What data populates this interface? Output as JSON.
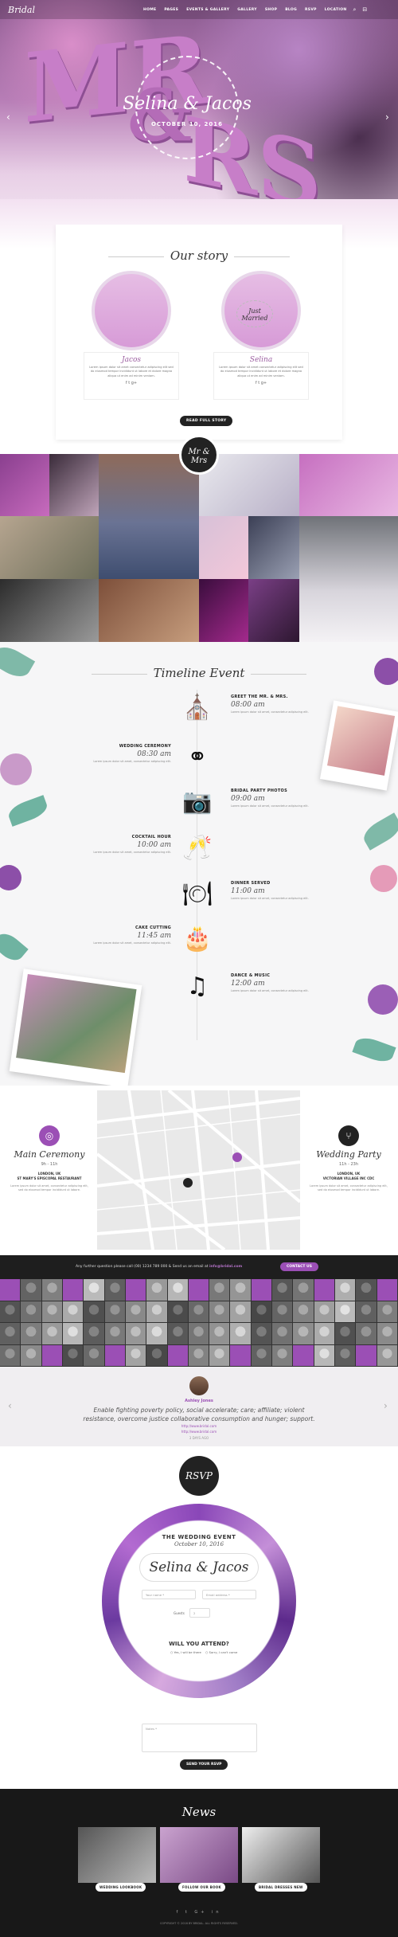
{
  "brand": "Bridal",
  "nav": [
    "HOME",
    "PAGES",
    "EVENTS & GALLERY",
    "GALLERY",
    "SHOP",
    "BLOG",
    "RSVP",
    "LOCATION"
  ],
  "hero": {
    "names": "Selina & Jacos",
    "date": "OCTOBER 10, 2016"
  },
  "story": {
    "title": "Our story",
    "ornament": "Just Married",
    "groom": {
      "name": "Jacos",
      "text": "Lorem ipsum dolor sit amet consectetur adipiscing elit sed do eiusmod tempor incididunt ut labore et dolore magna aliqua ut enim ad minim veniam.",
      "social": "f  t  g+"
    },
    "bride": {
      "name": "Selina",
      "text": "Lorem ipsum dolor sit amet consectetur adipiscing elit sed do eiusmod tempor incididunt ut labore et dolore magna aliqua ut enim ad minim veniam.",
      "social": "f  t  g+"
    },
    "button": "READ FULL STORY"
  },
  "gallery_badge": "Mr & Mrs",
  "timeline": {
    "title": "Timeline Event",
    "events": [
      {
        "title": "GREET THE MR. & MRS.",
        "time": "08:00 am",
        "desc": "Lorem ipsum dolor sit amet, consectetur adipiscing elit.",
        "icon": "church-icon",
        "glyph": "⛪"
      },
      {
        "title": "WEDDING CEREMONY",
        "time": "08:30 am",
        "desc": "Lorem ipsum dolor sit amet, consectetur adipiscing elit.",
        "icon": "rings-icon",
        "glyph": "⚭"
      },
      {
        "title": "BRIDAL PARTY PHOTOS",
        "time": "09:00 am",
        "desc": "Lorem ipsum dolor sit amet, consectetur adipiscing elit.",
        "icon": "camera-icon",
        "glyph": "📷"
      },
      {
        "title": "COCKTAIL HOUR",
        "time": "10:00 am",
        "desc": "Lorem ipsum dolor sit amet, consectetur adipiscing elit.",
        "icon": "glasses-icon",
        "glyph": "🥂"
      },
      {
        "title": "DINNER SERVED",
        "time": "11:00 am",
        "desc": "Lorem ipsum dolor sit amet, consectetur adipiscing elit.",
        "icon": "dinner-icon",
        "glyph": "🍽"
      },
      {
        "title": "CAKE CUTTING",
        "time": "11:45 am",
        "desc": "Lorem ipsum dolor sit amet, consectetur adipiscing elit.",
        "icon": "cake-icon",
        "glyph": "🎂"
      },
      {
        "title": "DANCE & MUSIC",
        "time": "12:00 am",
        "desc": "Lorem ipsum dolor sit amet, consectetur adipiscing elit.",
        "icon": "music-icon",
        "glyph": "♫"
      }
    ]
  },
  "location": {
    "ceremony": {
      "title": "Main Ceremony",
      "time": "9h - 11h",
      "address": "LONDON, UK\nST MARY'S EPISCOPAL RESTAURANT",
      "desc": "Lorem ipsum dolor sit amet, consectetur adipiscing elit, sed do eiusmod tempor incididunt ut labore."
    },
    "party": {
      "title": "Wedding Party",
      "time": "11h - 23h",
      "address": "LONDON, UK\nVICTORIAN VILLAGE INC CDC",
      "desc": "Lorem ipsum dolor sit amet, consectetur adipiscing elit, sed do eiusmod tempor incididunt ut labore."
    }
  },
  "contact": {
    "text": "Any further question please call (00) 1234 789 000 & Send us an email at ",
    "email": "info@bridal.com",
    "button": "CONTACT US"
  },
  "testimonial": {
    "name": "Ashley Jones",
    "quote": "Enable fighting poverty policy, social accelerate; care; affiliate; violent resistance, overcome justice collaborative consumption and hunger; support.",
    "link1": "http://www.bridal.com",
    "link2": "http://www.bridal.com",
    "ago": "3 DAYS AGO"
  },
  "rsvp": {
    "badge": "RSVP",
    "event_label": "THE WEDDING EVENT",
    "event_date": "October 10, 2016",
    "names": "Selina & Jacos",
    "name_placeholder": "Your name *",
    "email_placeholder": "Email address *",
    "guests_label": "Guests",
    "guests_value": "2",
    "question": "WILL YOU ATTEND?",
    "opt_yes": "Yes, I will be there",
    "opt_no": "Sorry, I can't come",
    "message_placeholder": "Notes *",
    "button": "SEND YOUR RSVP"
  },
  "news": {
    "title": "News",
    "items": [
      "WEDDING LOOKBOOK",
      "FOLLOW OUR BOOK",
      "BRIDAL DRESSES NEW"
    ]
  },
  "footer": {
    "social": "f t G+ in",
    "copyright": "COPYRIGHT © 2016 BY BRIDAL. ALL RIGHTS RESERVED."
  },
  "colors": {
    "accent": "#9b4fb5",
    "dark": "#1e1e1e"
  }
}
